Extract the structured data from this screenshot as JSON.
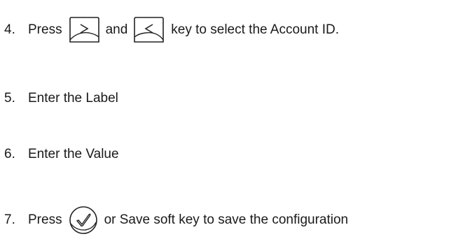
{
  "steps": [
    {
      "number": "4.",
      "press": "Press",
      "and": "and",
      "text": "key to select the Account ID.",
      "icons": [
        "right-arrow-key-icon",
        "left-arrow-key-icon"
      ]
    },
    {
      "number": "5.",
      "text": "Enter the Label"
    },
    {
      "number": "6.",
      "text": "Enter the Value"
    },
    {
      "number": "7.",
      "press": "Press",
      "text": "or Save soft key to save the configuration",
      "icons": [
        "ok-check-key-icon"
      ]
    }
  ]
}
